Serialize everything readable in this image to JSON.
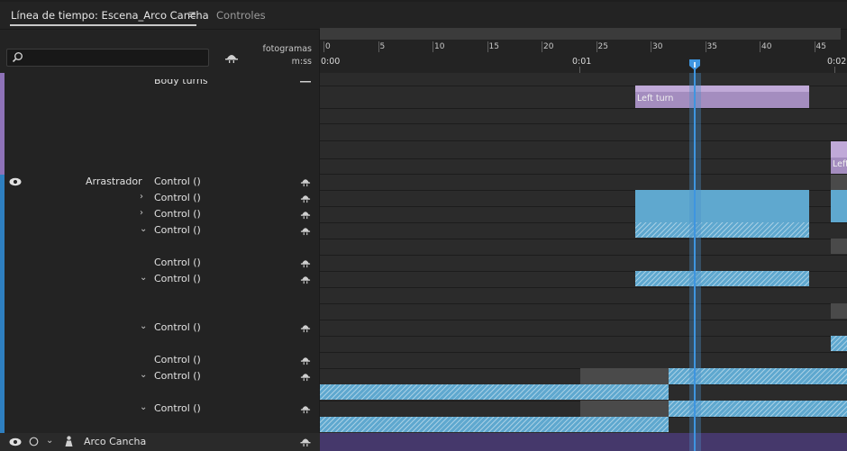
{
  "tabs": {
    "active_label": "Línea de tiempo: Escena_Arco Cancha",
    "menu_glyph": "≡",
    "second_label": "Controles"
  },
  "search": {
    "placeholder": "",
    "value": ""
  },
  "ruler": {
    "frames_label": "fotogramas",
    "time_label": "m:ss",
    "frame_ticks": [
      "0",
      "5",
      "10",
      "15",
      "20",
      "25",
      "30",
      "35",
      "40",
      "45"
    ],
    "time_marks": [
      "0:00",
      "0:01",
      "0:02"
    ],
    "playhead_frame": 34
  },
  "layers": {
    "top_partial_label": "Body turns",
    "arrastrador": "Arrastrador",
    "arco_cancha": "Arco Cancha",
    "controls": [
      {
        "label": "Control ()",
        "chevron": ""
      },
      {
        "label": "Control ()",
        "chevron": "›"
      },
      {
        "label": "Control ()",
        "chevron": "›"
      },
      {
        "label": "Control ()",
        "chevron": "⌄"
      },
      {
        "label": "Control ()",
        "chevron": ""
      },
      {
        "label": "Control ()",
        "chevron": "⌄"
      },
      {
        "label": "Control ()",
        "chevron": "⌄"
      },
      {
        "label": "Control ()",
        "chevron": ""
      },
      {
        "label": "Control ()",
        "chevron": "⌄"
      },
      {
        "label": "Control ()",
        "chevron": "⌄"
      }
    ]
  },
  "clips": {
    "left_turn": "Left turn",
    "left_turn_cut": "Left"
  },
  "icons": {
    "eye": "eye-icon",
    "search": "search-icon",
    "puppet": "puppet-icon",
    "record": "circle-icon",
    "person": "person-icon"
  },
  "colors": {
    "accent_blue": "#5fa8cf",
    "accent_purple": "#a48dbf",
    "playhead": "#3e95e0",
    "layer_track": "#45386b"
  }
}
